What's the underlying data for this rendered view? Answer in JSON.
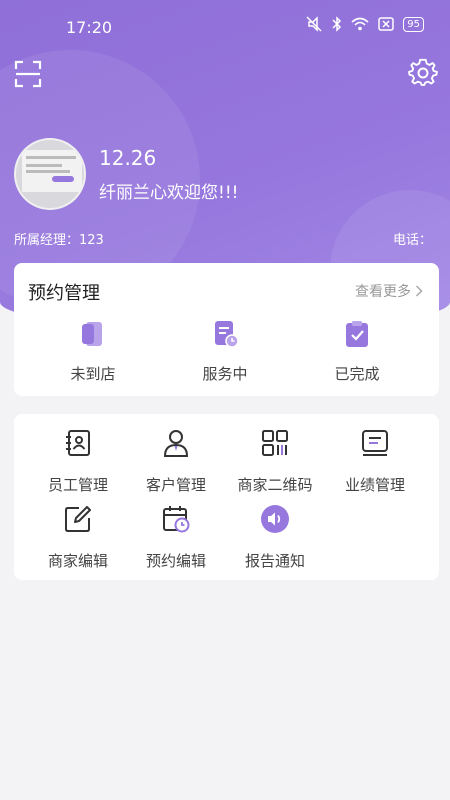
{
  "status_bar": {
    "time": "17:20",
    "battery": "95",
    "icons": [
      "mute-icon",
      "bluetooth-icon",
      "wifi-icon",
      "sim-off-icon",
      "battery-icon"
    ]
  },
  "header": {
    "scan_icon": "scan-icon",
    "settings_icon": "gear-icon"
  },
  "profile": {
    "name": "12.26",
    "welcome": "纤丽兰心欢迎您!!!",
    "manager": "所属经理：123",
    "phone": "电话："
  },
  "appointment": {
    "title": "预约管理",
    "more": "查看更多",
    "items": [
      {
        "label": "未到店",
        "icon": "card-icon"
      },
      {
        "label": "服务中",
        "icon": "service-doc-icon"
      },
      {
        "label": "已完成",
        "icon": "clipboard-check-icon"
      }
    ]
  },
  "menu": {
    "items": [
      {
        "label": "员工管理",
        "icon": "staff-book-icon"
      },
      {
        "label": "客户管理",
        "icon": "customer-icon"
      },
      {
        "label": "商家二维码",
        "icon": "qrcode-icon"
      },
      {
        "label": "业绩管理",
        "icon": "performance-icon"
      },
      {
        "label": "商家编辑",
        "icon": "edit-icon"
      },
      {
        "label": "预约编辑",
        "icon": "calendar-clock-icon"
      },
      {
        "label": "报告通知",
        "icon": "speaker-icon"
      }
    ]
  },
  "colors": {
    "accent": "#9677dd",
    "accent_light": "#b9a3ea",
    "background": "#f3f3f5"
  }
}
